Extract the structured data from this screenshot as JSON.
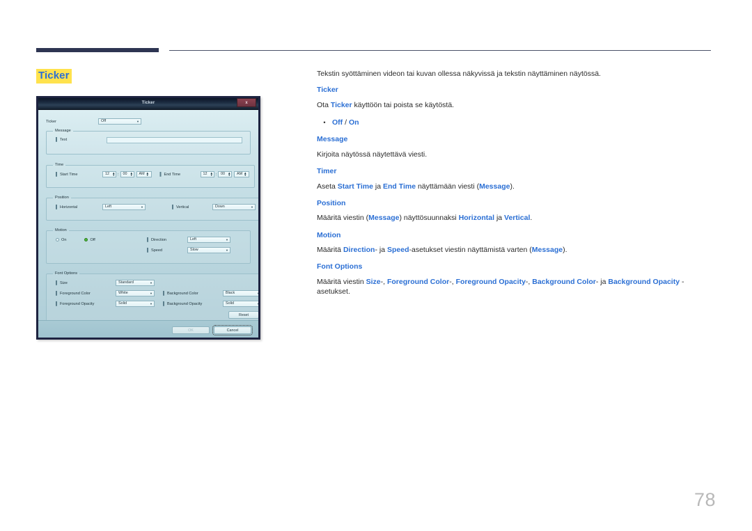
{
  "page": {
    "number": "78",
    "section_title": "Ticker",
    "title_highlight_color": "#ffe24d",
    "accent_color": "#2b6fd4",
    "rule_color": "#2e3552"
  },
  "content": {
    "lead": "Tekstin syöttäminen videon tai kuvan ollessa näkyvissä ja tekstin näyttäminen näytössä.",
    "sections": [
      {
        "heading": "Ticker",
        "body_plain": "Ota Ticker käyttöön tai poista se käytöstä.",
        "bullet": "Off / On"
      },
      {
        "heading": "Message",
        "body_plain": "Kirjoita näytössä näytettävä viesti."
      },
      {
        "heading": "Timer",
        "body_plain": "Aseta Start Time ja End Time näyttämään viesti (Message)."
      },
      {
        "heading": "Position",
        "body_plain": "Määritä viestin (Message) näyttösuunnaksi Horizontal ja Vertical."
      },
      {
        "heading": "Motion",
        "body_plain": "Määritä Direction- ja Speed-asetukset viestin näyttämistä varten (Message)."
      },
      {
        "heading": "Font Options",
        "body_plain": "Määritä viestin Size-, Foreground Color-, Foreground Opacity-, Background Color- ja Background Opacity -asetukset."
      }
    ],
    "text_fragments": {
      "ticker_1": "Ota ",
      "ticker_2": "Ticker",
      "ticker_3": " käyttöön tai poista se käytöstä.",
      "bullet_off": "Off",
      "bullet_sep": " / ",
      "bullet_on": "On",
      "timer_1": "Aseta ",
      "timer_2": "Start Time",
      "timer_3": " ja ",
      "timer_4": "End Time",
      "timer_5": " näyttämään viesti (",
      "timer_6": "Message",
      "timer_7": ").",
      "pos_1": "Määritä viestin (",
      "pos_2": "Message",
      "pos_3": ") näyttösuunnaksi ",
      "pos_4": "Horizontal",
      "pos_5": " ja ",
      "pos_6": "Vertical",
      "pos_7": ".",
      "mot_1": "Määritä ",
      "mot_2": "Direction",
      "mot_3": "- ja ",
      "mot_4": "Speed",
      "mot_5": "-asetukset viestin näyttämistä varten (",
      "mot_6": "Message",
      "mot_7": ").",
      "font_1": "Määritä viestin ",
      "font_2": "Size",
      "font_3": "-, ",
      "font_4": "Foreground Color",
      "font_5": "-, ",
      "font_6": "Foreground Opacity",
      "font_7": "-, ",
      "font_8": "Background Color",
      "font_9": "- ja ",
      "font_10": "Background Opacity",
      "font_11": " -asetukset."
    }
  },
  "dialog": {
    "title": "Ticker",
    "close_label": "x",
    "ticker_row": {
      "label": "Ticker",
      "value": "Off"
    },
    "message_group": {
      "legend": "Message",
      "text_label": "Text",
      "text_value": "",
      "text_placeholder": ""
    },
    "time_group": {
      "legend": "Time",
      "start_label": "Start Time",
      "start_hour": "12",
      "start_minute": "00",
      "start_meridiem": "AM",
      "end_label": "End Time",
      "end_hour": "12",
      "end_minute": "00",
      "end_meridiem": "AM"
    },
    "position_group": {
      "legend": "Position",
      "horizontal_label": "Horizontal",
      "horizontal_value": "Left",
      "vertical_label": "Vertical",
      "vertical_value": "Down"
    },
    "motion_group": {
      "legend": "Motion",
      "radio_on": "On",
      "radio_off": "Off",
      "selected": "Off",
      "direction_label": "Direction",
      "direction_value": "Left",
      "speed_label": "Speed",
      "speed_value": "Slow"
    },
    "font_group": {
      "legend": "Font Options",
      "size_label": "Size",
      "size_value": "Standard",
      "fg_color_label": "Foreground Color",
      "fg_color_value": "White",
      "bg_color_label": "Background Color",
      "bg_color_value": "Black",
      "fg_opacity_label": "Foreground Opacity",
      "fg_opacity_value": "Solid",
      "bg_opacity_label": "Background Opacity",
      "bg_opacity_value": "Solid",
      "reset_label": "Reset"
    },
    "footer": {
      "ok_label": "OK",
      "cancel_label": "Cancel"
    }
  }
}
